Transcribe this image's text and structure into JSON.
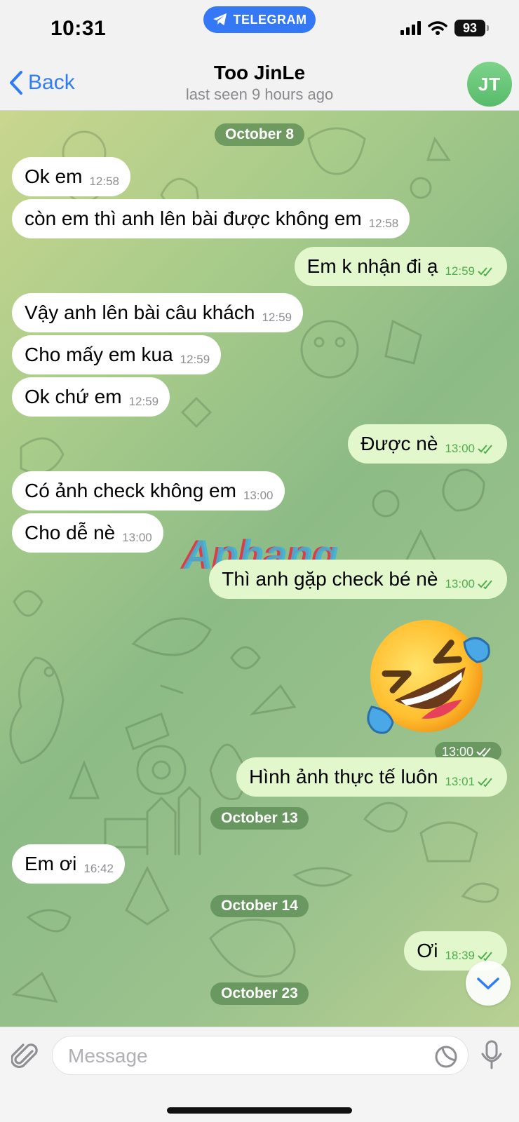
{
  "status_bar": {
    "time": "10:31",
    "pill_label": "TELEGRAM",
    "battery": "93"
  },
  "header": {
    "back_label": "Back",
    "contact_name": "Too JinLe",
    "last_seen": "last seen 9 hours ago",
    "avatar_initials": "JT"
  },
  "dates": {
    "d1": "October 8",
    "d2": "October 13",
    "d3": "October 14",
    "d4": "October 23"
  },
  "messages": [
    {
      "text": "Ok em",
      "time": "12:58",
      "dir": "in"
    },
    {
      "text": "còn em thì anh lên bài được không em",
      "time": "12:58",
      "dir": "in"
    },
    {
      "text": "Em k nhận đi ạ",
      "time": "12:59",
      "dir": "out"
    },
    {
      "text": "Vậy anh lên bài câu khách",
      "time": "12:59",
      "dir": "in"
    },
    {
      "text": "Cho mấy em kua",
      "time": "12:59",
      "dir": "in"
    },
    {
      "text": "Ok chứ em",
      "time": "12:59",
      "dir": "in"
    },
    {
      "text": "Được nè",
      "time": "13:00",
      "dir": "out"
    },
    {
      "text": "Có ảnh check không em",
      "time": "13:00",
      "dir": "in"
    },
    {
      "text": "Cho dễ nè",
      "time": "13:00",
      "dir": "in"
    },
    {
      "text": "Thì anh gặp check bé nè",
      "time": "13:00",
      "dir": "out"
    },
    {
      "text": "Hình ảnh thực tế luôn",
      "time": "13:01",
      "dir": "out"
    },
    {
      "text": "Em ơi",
      "time": "16:42",
      "dir": "in"
    },
    {
      "text": "Ơi",
      "time": "18:39",
      "dir": "out"
    }
  ],
  "emoji_message": {
    "emoji": "rolling-on-floor-laughing",
    "time": "13:00"
  },
  "watermark": "Aphang",
  "input": {
    "placeholder": "Message"
  },
  "colors": {
    "accent": "#2f7cf6",
    "out_bubble": "#e2f7cb",
    "in_bubble": "#ffffff",
    "read_ticks": "#4fae4e"
  }
}
